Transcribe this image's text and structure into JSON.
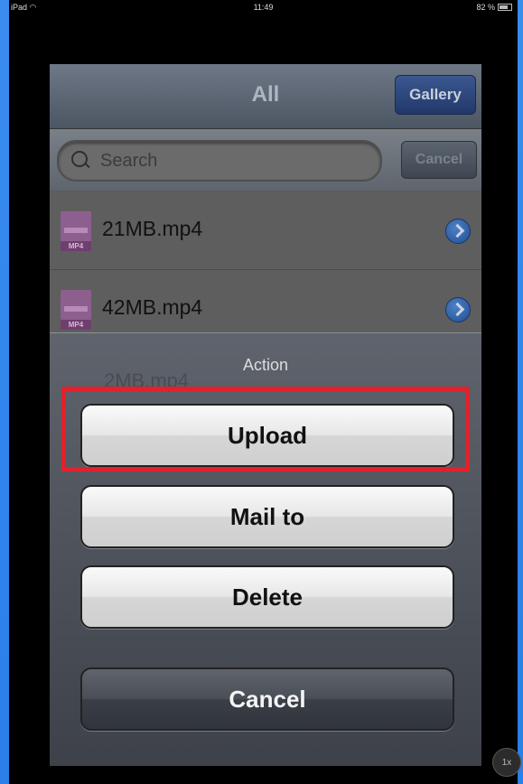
{
  "status_bar": {
    "device": "iPad",
    "wifi_icon": "wifi-icon",
    "time": "11:49",
    "battery": "82 %"
  },
  "nav": {
    "title": "All",
    "gallery_label": "Gallery"
  },
  "search": {
    "placeholder": "Search",
    "cancel_label": "Cancel"
  },
  "files": [
    {
      "name": "21MB.mp4",
      "type_tag": "MP4"
    },
    {
      "name": "42MB.mp4",
      "type_tag": "MP4"
    }
  ],
  "action_sheet": {
    "title": "Action",
    "ghost_text": "2MB.mp4",
    "buttons": {
      "upload": "Upload",
      "mail": "Mail to",
      "delete": "Delete",
      "cancel": "Cancel"
    }
  },
  "zoom_badge": "1x",
  "colors": {
    "highlight": "#e3202b",
    "background": "#2a7fe8"
  }
}
